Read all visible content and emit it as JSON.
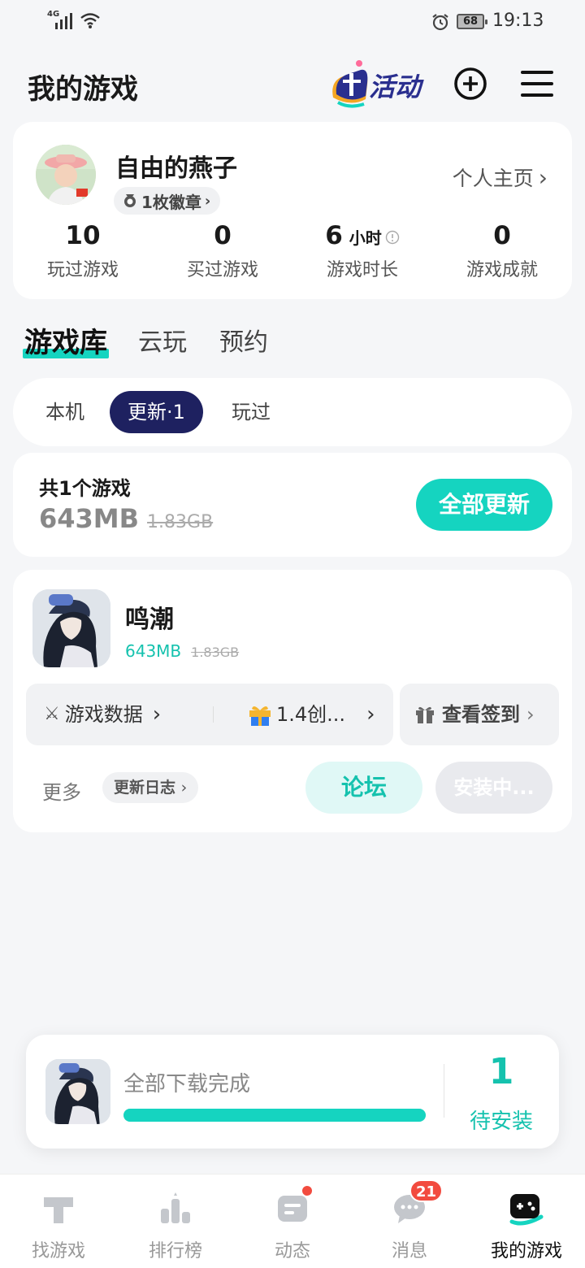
{
  "status_bar": {
    "network": "4G",
    "battery": "68",
    "time": "19:13"
  },
  "header": {
    "title": "我的游戏",
    "activity_label": "活动"
  },
  "profile": {
    "username": "自由的燕子",
    "badge": "1枚徽章",
    "homepage_link": "个人主页",
    "stats": [
      {
        "value": "10",
        "unit": "",
        "label": "玩过游戏"
      },
      {
        "value": "0",
        "unit": "",
        "label": "买过游戏"
      },
      {
        "value": "6",
        "unit": "小时",
        "label": "游戏时长"
      },
      {
        "value": "0",
        "unit": "",
        "label": "游戏成就"
      }
    ]
  },
  "tabs": [
    {
      "label": "游戏库",
      "active": true
    },
    {
      "label": "云玩",
      "active": false
    },
    {
      "label": "预约",
      "active": false
    }
  ],
  "filters": [
    {
      "label": "本机",
      "active": false
    },
    {
      "label": "更新·1",
      "active": true
    },
    {
      "label": "玩过",
      "active": false
    }
  ],
  "update_summary": {
    "count_text": "共1个游戏",
    "size": "643MB",
    "original_size": "1.83GB",
    "update_all_button": "全部更新"
  },
  "game": {
    "name": "鸣潮",
    "size": "643MB",
    "original_size": "1.83GB",
    "game_data_link": "游戏数据",
    "promo_text": "1.4创...",
    "signin_button": "查看签到",
    "more_label": "更多",
    "changelog_button": "更新日志",
    "forum_button": "论坛",
    "install_button": "安装中..."
  },
  "download_panel": {
    "status_text": "全部下载完成",
    "progress": 1.0,
    "pending_count": "1",
    "pending_label": "待安装"
  },
  "bottom_nav": [
    {
      "label": "找游戏",
      "icon": "find-game-icon",
      "active": false
    },
    {
      "label": "排行榜",
      "icon": "ranking-icon",
      "active": false
    },
    {
      "label": "动态",
      "icon": "feed-icon",
      "active": false,
      "dot": true
    },
    {
      "label": "消息",
      "icon": "message-icon",
      "active": false,
      "badge": "21"
    },
    {
      "label": "我的游戏",
      "icon": "my-games-icon",
      "active": true
    }
  ],
  "colors": {
    "accent": "#15d4c0",
    "accent_text": "#15c2ae",
    "filter_active": "#1e2160",
    "badge_red": "#f24b3f",
    "background": "#f5f6f8"
  }
}
